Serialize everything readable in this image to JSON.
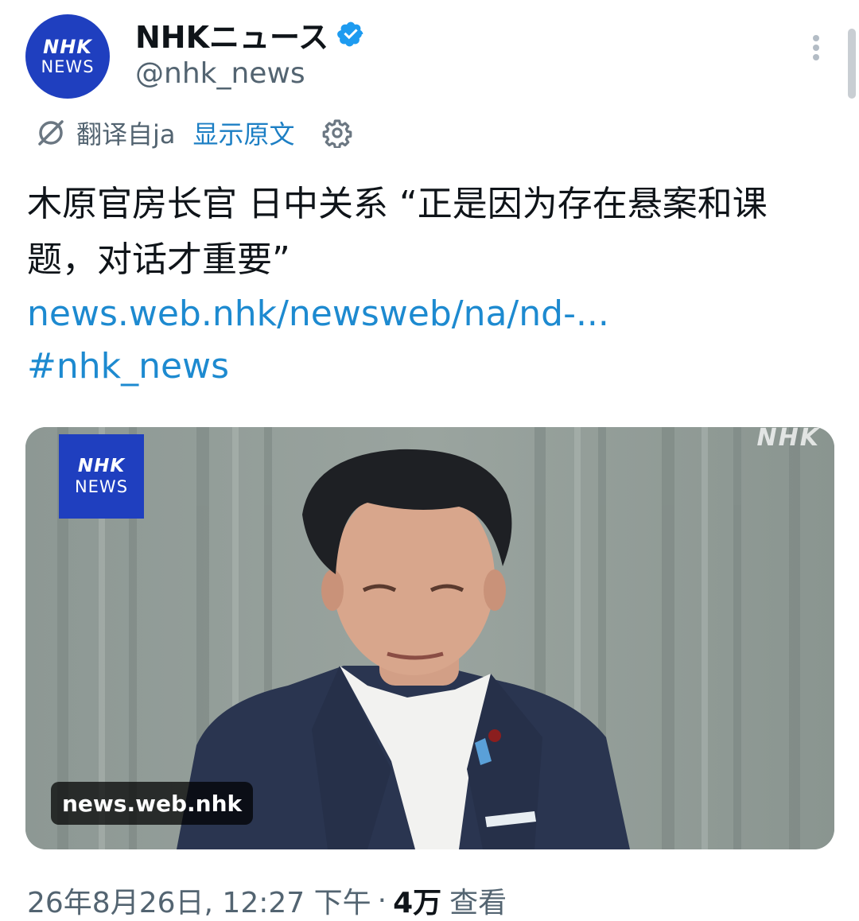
{
  "account": {
    "avatar_line1": "NHK",
    "avatar_line2": "NEWS",
    "display_name": "NHKニュース",
    "handle": "@nhk_news",
    "verified": true
  },
  "translation": {
    "translated_from": "翻译自ja",
    "show_original": "显示原文"
  },
  "tweet": {
    "text": "木原官房长官 日中关系 “正是因为存在悬案和课题，对话才重要”",
    "link": "news.web.nhk/newsweb/na/nd-...",
    "hashtag": "#nhk_news"
  },
  "media": {
    "badge_line1": "NHK",
    "badge_line2": "NEWS",
    "watermark": "NHK",
    "source_label": "news.web.nhk"
  },
  "meta": {
    "timestamp": "26年8月26日, 12:27 下午",
    "separator": "·",
    "views_count": "4万",
    "views_label": "查看"
  },
  "colors": {
    "brand_blue": "#1f3fbf",
    "link_blue": "#1d8ad0",
    "verified_blue": "#1d9bf0",
    "muted_text": "#536471"
  },
  "icons": {
    "verified": "verified-badge-icon",
    "translate": "translate-icon",
    "settings": "gear-icon",
    "more": "more-vertical-icon"
  }
}
